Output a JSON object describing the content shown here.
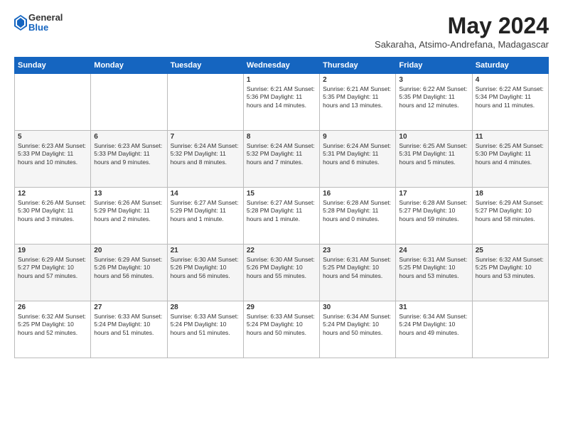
{
  "header": {
    "logo": {
      "general": "General",
      "blue": "Blue"
    },
    "title": "May 2024",
    "location": "Sakaraha, Atsimo-Andrefana, Madagascar"
  },
  "weekdays": [
    "Sunday",
    "Monday",
    "Tuesday",
    "Wednesday",
    "Thursday",
    "Friday",
    "Saturday"
  ],
  "weeks": [
    [
      {
        "day": "",
        "info": ""
      },
      {
        "day": "",
        "info": ""
      },
      {
        "day": "",
        "info": ""
      },
      {
        "day": "1",
        "info": "Sunrise: 6:21 AM\nSunset: 5:36 PM\nDaylight: 11 hours\nand 14 minutes."
      },
      {
        "day": "2",
        "info": "Sunrise: 6:21 AM\nSunset: 5:35 PM\nDaylight: 11 hours\nand 13 minutes."
      },
      {
        "day": "3",
        "info": "Sunrise: 6:22 AM\nSunset: 5:35 PM\nDaylight: 11 hours\nand 12 minutes."
      },
      {
        "day": "4",
        "info": "Sunrise: 6:22 AM\nSunset: 5:34 PM\nDaylight: 11 hours\nand 11 minutes."
      }
    ],
    [
      {
        "day": "5",
        "info": "Sunrise: 6:23 AM\nSunset: 5:33 PM\nDaylight: 11 hours\nand 10 minutes."
      },
      {
        "day": "6",
        "info": "Sunrise: 6:23 AM\nSunset: 5:33 PM\nDaylight: 11 hours\nand 9 minutes."
      },
      {
        "day": "7",
        "info": "Sunrise: 6:24 AM\nSunset: 5:32 PM\nDaylight: 11 hours\nand 8 minutes."
      },
      {
        "day": "8",
        "info": "Sunrise: 6:24 AM\nSunset: 5:32 PM\nDaylight: 11 hours\nand 7 minutes."
      },
      {
        "day": "9",
        "info": "Sunrise: 6:24 AM\nSunset: 5:31 PM\nDaylight: 11 hours\nand 6 minutes."
      },
      {
        "day": "10",
        "info": "Sunrise: 6:25 AM\nSunset: 5:31 PM\nDaylight: 11 hours\nand 5 minutes."
      },
      {
        "day": "11",
        "info": "Sunrise: 6:25 AM\nSunset: 5:30 PM\nDaylight: 11 hours\nand 4 minutes."
      }
    ],
    [
      {
        "day": "12",
        "info": "Sunrise: 6:26 AM\nSunset: 5:30 PM\nDaylight: 11 hours\nand 3 minutes."
      },
      {
        "day": "13",
        "info": "Sunrise: 6:26 AM\nSunset: 5:29 PM\nDaylight: 11 hours\nand 2 minutes."
      },
      {
        "day": "14",
        "info": "Sunrise: 6:27 AM\nSunset: 5:29 PM\nDaylight: 11 hours\nand 1 minute."
      },
      {
        "day": "15",
        "info": "Sunrise: 6:27 AM\nSunset: 5:28 PM\nDaylight: 11 hours\nand 1 minute."
      },
      {
        "day": "16",
        "info": "Sunrise: 6:28 AM\nSunset: 5:28 PM\nDaylight: 11 hours\nand 0 minutes."
      },
      {
        "day": "17",
        "info": "Sunrise: 6:28 AM\nSunset: 5:27 PM\nDaylight: 10 hours\nand 59 minutes."
      },
      {
        "day": "18",
        "info": "Sunrise: 6:29 AM\nSunset: 5:27 PM\nDaylight: 10 hours\nand 58 minutes."
      }
    ],
    [
      {
        "day": "19",
        "info": "Sunrise: 6:29 AM\nSunset: 5:27 PM\nDaylight: 10 hours\nand 57 minutes."
      },
      {
        "day": "20",
        "info": "Sunrise: 6:29 AM\nSunset: 5:26 PM\nDaylight: 10 hours\nand 56 minutes."
      },
      {
        "day": "21",
        "info": "Sunrise: 6:30 AM\nSunset: 5:26 PM\nDaylight: 10 hours\nand 56 minutes."
      },
      {
        "day": "22",
        "info": "Sunrise: 6:30 AM\nSunset: 5:26 PM\nDaylight: 10 hours\nand 55 minutes."
      },
      {
        "day": "23",
        "info": "Sunrise: 6:31 AM\nSunset: 5:25 PM\nDaylight: 10 hours\nand 54 minutes."
      },
      {
        "day": "24",
        "info": "Sunrise: 6:31 AM\nSunset: 5:25 PM\nDaylight: 10 hours\nand 53 minutes."
      },
      {
        "day": "25",
        "info": "Sunrise: 6:32 AM\nSunset: 5:25 PM\nDaylight: 10 hours\nand 53 minutes."
      }
    ],
    [
      {
        "day": "26",
        "info": "Sunrise: 6:32 AM\nSunset: 5:25 PM\nDaylight: 10 hours\nand 52 minutes."
      },
      {
        "day": "27",
        "info": "Sunrise: 6:33 AM\nSunset: 5:24 PM\nDaylight: 10 hours\nand 51 minutes."
      },
      {
        "day": "28",
        "info": "Sunrise: 6:33 AM\nSunset: 5:24 PM\nDaylight: 10 hours\nand 51 minutes."
      },
      {
        "day": "29",
        "info": "Sunrise: 6:33 AM\nSunset: 5:24 PM\nDaylight: 10 hours\nand 50 minutes."
      },
      {
        "day": "30",
        "info": "Sunrise: 6:34 AM\nSunset: 5:24 PM\nDaylight: 10 hours\nand 50 minutes."
      },
      {
        "day": "31",
        "info": "Sunrise: 6:34 AM\nSunset: 5:24 PM\nDaylight: 10 hours\nand 49 minutes."
      },
      {
        "day": "",
        "info": ""
      }
    ]
  ]
}
